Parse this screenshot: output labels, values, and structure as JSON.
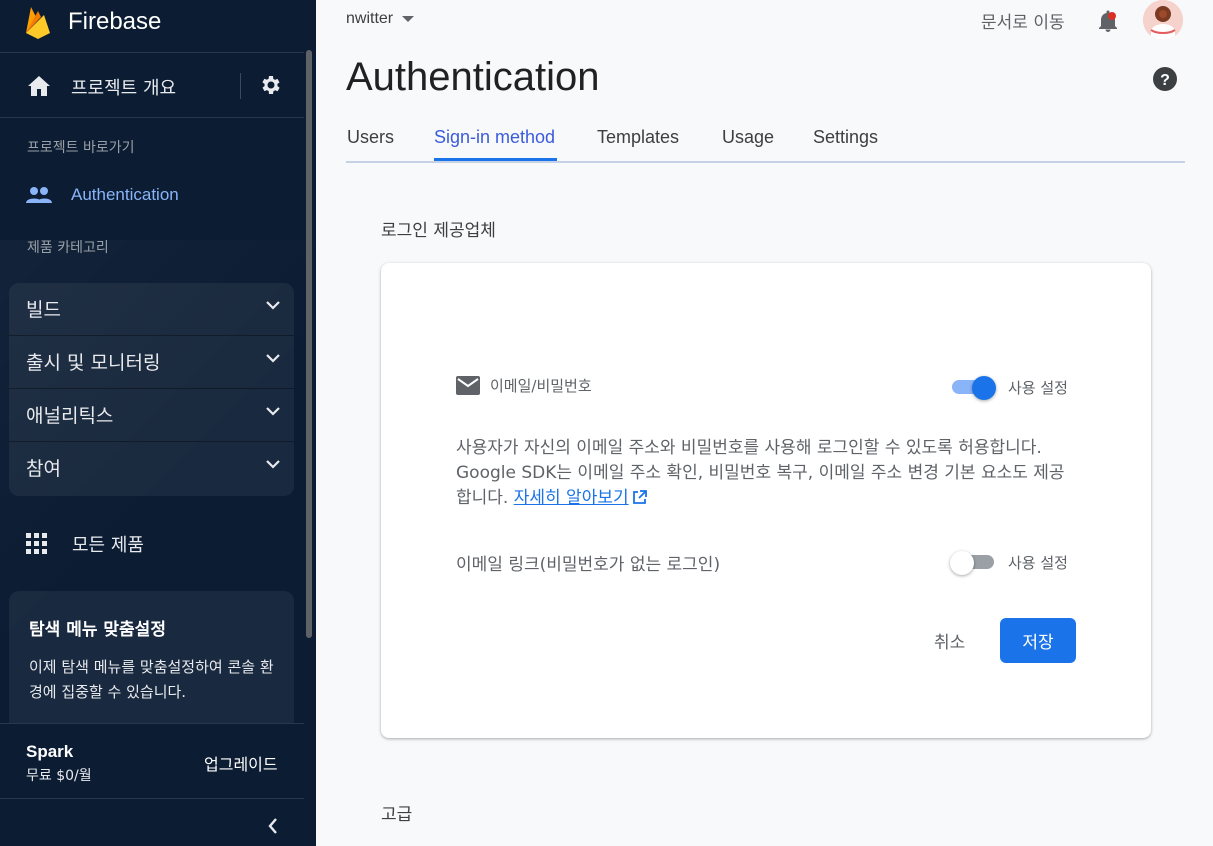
{
  "sidebar": {
    "brand": "Firebase",
    "overview_label": "프로젝트 개요",
    "shortcut_header": "프로젝트 바로가기",
    "shortcut_item": "Authentication",
    "category_header": "제품 카테고리",
    "categories": [
      {
        "label": "빌드"
      },
      {
        "label": "출시 및 모니터링"
      },
      {
        "label": "애널리틱스"
      },
      {
        "label": "참여"
      }
    ],
    "all_products": "모든 제품",
    "customize": {
      "title": "탐색 메뉴 맞춤설정",
      "description": "이제 탐색 메뉴를 맞춤설정하여 콘솔 환경에 집중할 수 있습니다."
    },
    "plan": {
      "name": "Spark",
      "price": "무료 $0/월",
      "upgrade": "업그레이드"
    }
  },
  "header": {
    "project": "nwitter",
    "docs_link": "문서로 이동"
  },
  "page": {
    "title": "Authentication",
    "tabs": [
      {
        "label": "Users"
      },
      {
        "label": "Sign-in method"
      },
      {
        "label": "Templates"
      },
      {
        "label": "Usage"
      },
      {
        "label": "Settings"
      }
    ],
    "active_tab": "Sign-in method",
    "section_title": "로그인 제공업체",
    "advanced_title": "고급"
  },
  "provider_card": {
    "provider_name": "이메일/비밀번호",
    "toggle_label": "사용 설정",
    "email_password_enabled": true,
    "description": "사용자가 자신의 이메일 주소와 비밀번호를 사용해 로그인할 수 있도록 허용합니다. Google SDK는 이메일 주소 확인, 비밀번호 복구, 이메일 주소 변경 기본 요소도 제공합니다.",
    "learn_more": "자세히 알아보기",
    "email_link_label": "이메일 링크(비밀번호가 없는 로그인)",
    "email_link_toggle_label": "사용 설정",
    "email_link_enabled": false,
    "cancel": "취소",
    "save": "저장"
  },
  "colors": {
    "sidebar_bg": "#0b1c33",
    "accent": "#1a73e8",
    "active_sidebar_text": "#8ab4f8"
  }
}
